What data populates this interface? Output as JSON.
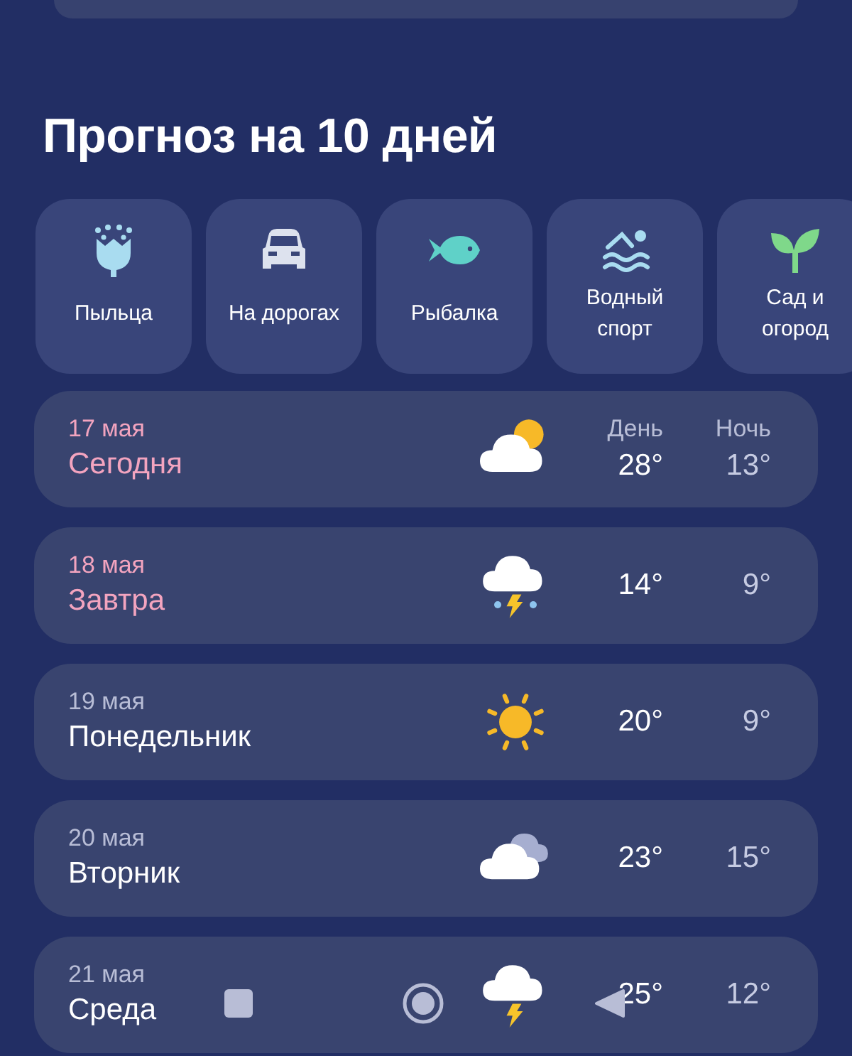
{
  "title": "Прогноз на 10 дней",
  "categories": [
    {
      "kind": "pollen",
      "label": "Пыльца"
    },
    {
      "kind": "roads",
      "label": "На дорогах"
    },
    {
      "kind": "fishing",
      "label": "Рыбалка"
    },
    {
      "kind": "water_sports",
      "label": "Водный спорт"
    },
    {
      "kind": "garden",
      "label": "Сад и огород"
    }
  ],
  "days": [
    {
      "date": "17 мая",
      "name": "Сегодня",
      "highlight": true,
      "kind": "partly_cloudy",
      "day_label": "День",
      "night_label": "Ночь",
      "day_temp": "28°",
      "night_temp": "13°"
    },
    {
      "date": "18 мая",
      "name": "Завтра",
      "highlight": true,
      "kind": "thunder_rain",
      "day_temp": "14°",
      "night_temp": "9°"
    },
    {
      "date": "19 мая",
      "name": "Понедельник",
      "highlight": false,
      "kind": "sunny",
      "day_temp": "20°",
      "night_temp": "9°"
    },
    {
      "date": "20 мая",
      "name": "Вторник",
      "highlight": false,
      "kind": "cloudy",
      "day_temp": "23°",
      "night_temp": "15°"
    },
    {
      "date": "21 мая",
      "name": "Среда",
      "highlight": false,
      "kind": "thunder",
      "day_temp": "25°",
      "night_temp": "12°"
    }
  ],
  "nav_bar": [
    {
      "kind": "recents"
    },
    {
      "kind": "home"
    },
    {
      "kind": "back"
    }
  ]
}
